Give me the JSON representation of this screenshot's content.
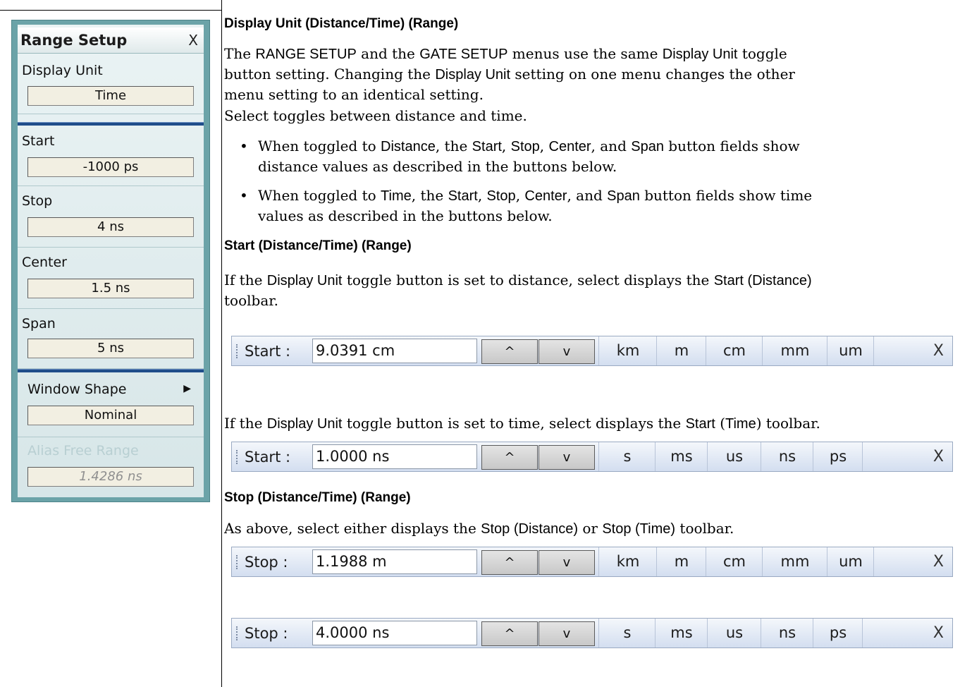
{
  "menu": {
    "title": "Range Setup",
    "close": "X",
    "display_unit": {
      "label": "Display Unit",
      "value": "Time"
    },
    "start": {
      "label": "Start",
      "value": "-1000 ps"
    },
    "stop": {
      "label": "Stop",
      "value": "4 ns"
    },
    "center": {
      "label": "Center",
      "value": "1.5 ns"
    },
    "span": {
      "label": "Span",
      "value": "5 ns"
    },
    "window_shape": {
      "label": "Window Shape",
      "arrow": "▶",
      "value": "Nominal"
    },
    "alias_free_range": {
      "label": "Alias Free Range",
      "value": "1.4286 ns"
    }
  },
  "doc": {
    "h1": "Display Unit (Distance/Time) (Range)",
    "p1": [
      "The ",
      "RANGE SETUP",
      " and the ",
      "GATE SETUP",
      " menus use the same ",
      "Display Unit",
      " toggle",
      "button setting. Changing the ",
      "Display Unit",
      " setting on one menu changes the other",
      "menu setting to an identical setting."
    ],
    "p2": "Select toggles between distance and time.",
    "bullet_dot": "•",
    "b1": [
      "When toggled to ",
      "Distance",
      ", the ",
      "Start",
      ", ",
      "Stop",
      ", ",
      "Center",
      ", and ",
      "Span",
      " button fields show",
      "distance values as described in the buttons below."
    ],
    "b2": [
      "When toggled to ",
      "Time",
      ", the ",
      "Start",
      ", ",
      "Stop",
      ", ",
      "Center",
      ", and ",
      "Span",
      " button fields show time",
      "values as described in the buttons below."
    ],
    "h2": "Start (Distance/Time) (Range)",
    "p3": [
      "If the ",
      "Display Unit",
      " toggle button is set to distance, select displays the ",
      "Start (Distance)",
      "toolbar."
    ],
    "p4": [
      "If the ",
      "Display Unit",
      " toggle button is set to time, select displays the ",
      "Start",
      " (",
      "Time",
      ") toolbar."
    ],
    "h3": "Stop (Distance/Time) (Range)",
    "p5": [
      "As above, select either displays the ",
      "Stop (Distance)",
      " or ",
      "Stop (Time)",
      " toolbar."
    ]
  },
  "toolbars": {
    "start_distance": {
      "label": "Start :",
      "value": "9.0391 cm",
      "up": "^",
      "down": "v",
      "units": [
        "km",
        "m",
        "cm",
        "mm",
        "um"
      ],
      "close": "X"
    },
    "start_time": {
      "label": "Start :",
      "value": "1.0000 ns",
      "up": "^",
      "down": "v",
      "units": [
        "s",
        "ms",
        "us",
        "ns",
        "ps"
      ],
      "close": "X"
    },
    "stop_distance": {
      "label": "Stop :",
      "value": "1.1988  m",
      "up": "^",
      "down": "v",
      "units": [
        "km",
        "m",
        "cm",
        "mm",
        "um"
      ],
      "close": "X"
    },
    "stop_time": {
      "label": "Stop :",
      "value": "4.0000 ns",
      "up": "^",
      "down": "v",
      "units": [
        "s",
        "ms",
        "us",
        "ns",
        "ps"
      ],
      "close": "X"
    }
  }
}
